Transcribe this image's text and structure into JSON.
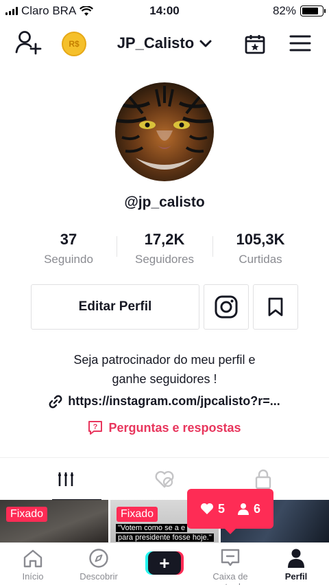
{
  "status_bar": {
    "carrier": "Claro BRA",
    "time": "14:00",
    "battery_text": "82%",
    "battery_level": 0.82
  },
  "header": {
    "username": "JP_Calisto",
    "coin_label": "R$"
  },
  "profile": {
    "handle": "@jp_calisto",
    "stats": [
      {
        "value": "37",
        "label": "Seguindo"
      },
      {
        "value": "17,2K",
        "label": "Seguidores"
      },
      {
        "value": "105,3K",
        "label": "Curtidas"
      }
    ],
    "edit_label": "Editar Perfil",
    "bio_line1": "Seja patrocinador do meu perfil e",
    "bio_line2": "ganhe seguidores !",
    "link": "https://instagram.com/jpcalisto?r=...",
    "qa_label": "Perguntas e respostas"
  },
  "videos": [
    {
      "badge": "Fixado",
      "caption": ""
    },
    {
      "badge": "Fixado",
      "caption_line1": "\"Votem como se a e",
      "caption_line2": "para presidente fosse hoje.\""
    },
    {
      "badge": "",
      "caption": ""
    }
  ],
  "notification": {
    "likes": "5",
    "followers": "6"
  },
  "bottom_nav": {
    "items": [
      {
        "label": "Início"
      },
      {
        "label": "Descobrir"
      },
      {
        "label": "+"
      },
      {
        "label": "Caixa de entrada"
      },
      {
        "label": "Perfil"
      }
    ]
  },
  "colors": {
    "accent": "#fe2c55",
    "text": "#161823",
    "secondary": "#8a8b91",
    "qa": "#e8365d"
  }
}
